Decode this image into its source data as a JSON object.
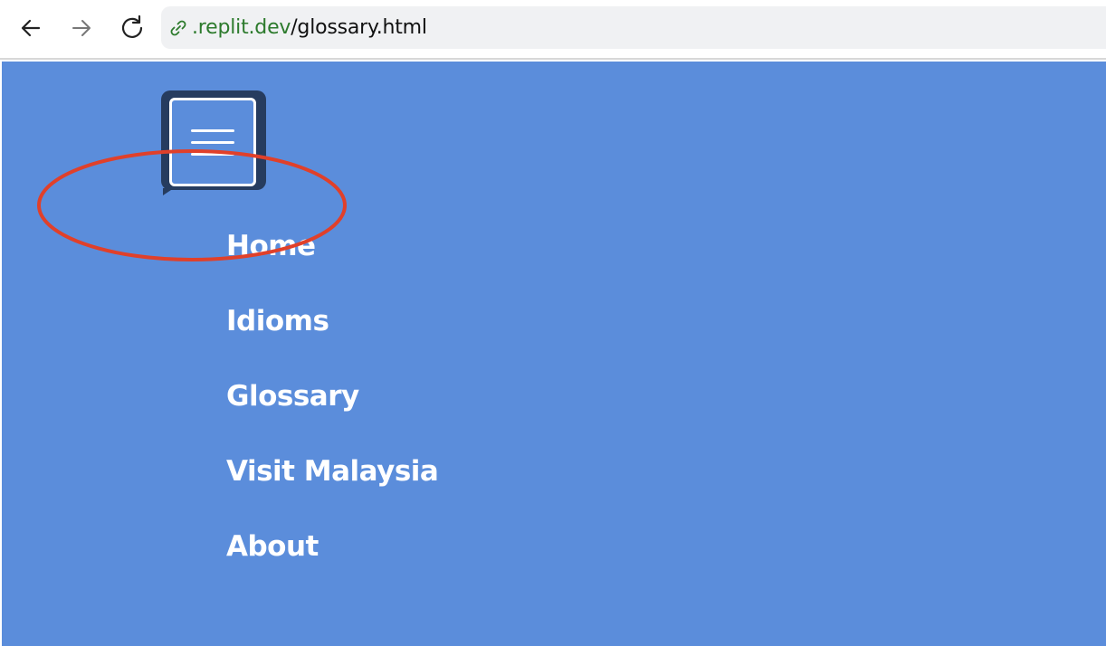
{
  "browser": {
    "url_host": ".replit.dev",
    "url_path": "/glossary.html",
    "icons": {
      "back": "back-arrow-icon",
      "forward": "forward-arrow-icon",
      "reload": "reload-icon",
      "link": "link-icon"
    }
  },
  "page": {
    "background_color": "#5b8ddb",
    "menu_button_icon": "hamburger-menu-icon",
    "nav_items": [
      {
        "label": "Home"
      },
      {
        "label": "Idioms"
      },
      {
        "label": "Glossary"
      },
      {
        "label": "Visit Malaysia"
      },
      {
        "label": "About"
      }
    ]
  },
  "annotation": {
    "shape": "ellipse",
    "color": "#e0402a"
  }
}
